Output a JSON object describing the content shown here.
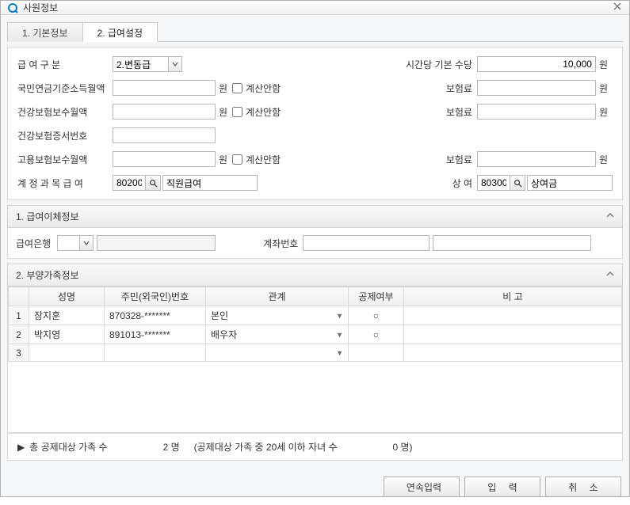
{
  "window": {
    "title": "사원정보"
  },
  "tabs": {
    "t1": "1. 기본정보",
    "t2": "2. 급여설정"
  },
  "form": {
    "payType": {
      "label": "급  여  구  분",
      "value": "2.변동급"
    },
    "hourlyWage": {
      "label": "시간당 기본 수당",
      "value": "10,000",
      "unit": "원"
    },
    "pensionBase": {
      "label": "국민연금기준소득월액",
      "unit": "원",
      "nocalc": "계산안함",
      "insLabel": "보험료",
      "insUnit": "원"
    },
    "healthBase": {
      "label": "건강보험보수월액",
      "unit": "원",
      "nocalc": "계산안함",
      "insLabel": "보험료",
      "insUnit": "원"
    },
    "healthCertNo": {
      "label": "건강보험증서번호"
    },
    "employBase": {
      "label": "고용보험보수월액",
      "unit": "원",
      "nocalc": "계산안함",
      "insLabel": "보험료",
      "insUnit": "원"
    },
    "acctPay": {
      "label": "계 정 과 목  급 여",
      "code": "80200",
      "name": "직원급여"
    },
    "acctBonus": {
      "label": "상  여",
      "code": "80300",
      "name": "상여금"
    }
  },
  "section1": {
    "title": "1. 급여이체정보",
    "bankLabel": "급여은행",
    "acctNoLabel": "계좌번호"
  },
  "section2": {
    "title": "2. 부양가족정보",
    "headers": {
      "name": "성명",
      "rrn": "주민(외국인)번호",
      "relation": "관계",
      "deduct": "공제여부",
      "remark": "비 고"
    },
    "rows": [
      {
        "no": "1",
        "name": "장지훈",
        "rrn": "870328-*******",
        "relation": "본인",
        "deduct": "○"
      },
      {
        "no": "2",
        "name": "박지영",
        "rrn": "891013-*******",
        "relation": "배우자",
        "deduct": "○"
      },
      {
        "no": "3",
        "name": "",
        "rrn": "",
        "relation": "",
        "deduct": ""
      }
    ],
    "summary": {
      "prefix": "총 공제대상 가족 수",
      "count": "2 명",
      "mid": "(공제대상 가족 중 20세 이하 자녀 수",
      "count2": "0 명)"
    }
  },
  "buttons": {
    "continuous": "연속입력",
    "submit": "입 력",
    "cancel": "취 소"
  }
}
